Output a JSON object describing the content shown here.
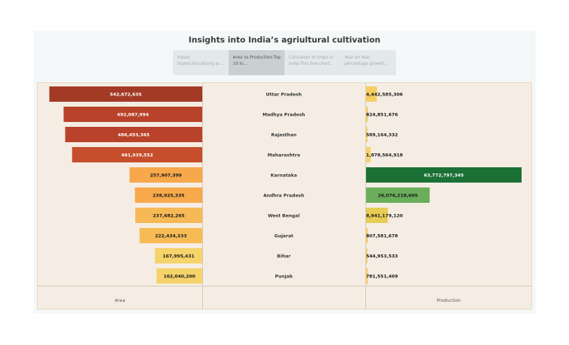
{
  "title": "Insights into India’s agriultural cultivation",
  "tabs": [
    {
      "label": "Indian States:Visualizing ar…",
      "active": false
    },
    {
      "label": "Area vs Production:Top 10 In…",
      "active": true
    },
    {
      "label": "Cutivation of crops in India-This line chart il…",
      "active": false
    },
    {
      "label": "Year on Year percentage growth of…",
      "active": false
    }
  ],
  "chart_data": {
    "type": "bar",
    "layout": "butterfly",
    "categories": [
      "Uttar Pradesh",
      "Madhya Pradesh",
      "Rajasthan",
      "Maharashtra",
      "Karnataka",
      "Andhra Pradesh",
      "West Bengal",
      "Gujarat",
      "Bihar",
      "Punjab"
    ],
    "series": [
      {
        "name": "Area",
        "values": [
          542672635,
          492087994,
          486453365,
          461939552,
          257907399,
          238925335,
          237682265,
          222434333,
          167995431,
          162040200
        ],
        "labels": [
          "542,672,635",
          "492,087,994",
          "486,453,365",
          "461,939,552",
          "257,907,399",
          "238,925,335",
          "237,682,265",
          "222,434,333",
          "167,995,431",
          "162,040,200"
        ],
        "colors": [
          "#a33a26",
          "#b8432a",
          "#b8432a",
          "#c64e2c",
          "#f6a84b",
          "#f7a94b",
          "#f7b955",
          "#f7bb56",
          "#f6d36b",
          "#f6d26b"
        ],
        "label_colors": [
          "#ffffff",
          "#ffffff",
          "#ffffff",
          "#ffffff",
          "#1a1a1a",
          "#1a1a1a",
          "#1a1a1a",
          "#1a1a1a",
          "#1a1a1a",
          "#1a1a1a"
        ]
      },
      {
        "name": "Production",
        "values": [
          4442585306,
          824851676,
          589164332,
          1878564918,
          63772797345,
          26076218605,
          8941179120,
          807581678,
          544953533,
          781551409
        ],
        "labels": [
          "4,442,585,306",
          "824,851,676",
          "589,164,332",
          "1,878,564,918",
          "63,772,797,345",
          "26,076,218,605",
          "8,941,179,120",
          "807,581,678",
          "544,953,533",
          "781,551,409"
        ],
        "colors": [
          "#f6cf62",
          "#f6d26b",
          "#f6d26b",
          "#f6d26b",
          "#1a7035",
          "#6aad5a",
          "#e7cc55",
          "#f6d26b",
          "#f6d26b",
          "#f6d26b"
        ],
        "label_colors": [
          "#1a1a1a",
          "#1a1a1a",
          "#1a1a1a",
          "#1a1a1a",
          "#ffffff",
          "#1a1a1a",
          "#1a1a1a",
          "#1a1a1a",
          "#1a1a1a",
          "#1a1a1a"
        ]
      }
    ],
    "xlabel_left": "Area",
    "xlabel_right": "Production",
    "xlim_area": [
      0,
      552000000
    ],
    "xlim_production": [
      0,
      63772797345
    ]
  }
}
